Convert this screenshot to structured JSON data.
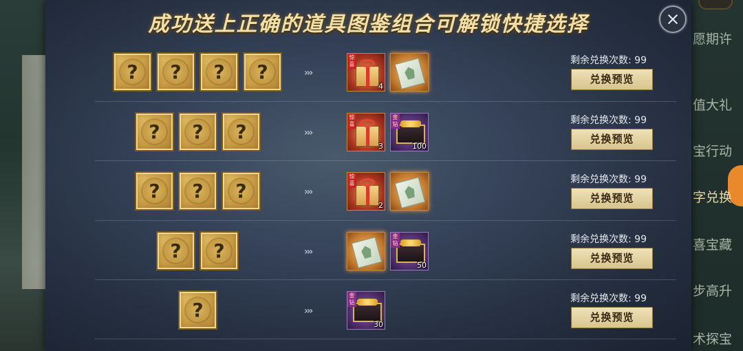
{
  "title": "成功送上正确的道具图鉴组合可解锁快捷选择",
  "sidebar": {
    "items": [
      {
        "label": "愿期许",
        "active": false
      },
      {
        "label": "值大礼",
        "active": false
      },
      {
        "label": "宝行动",
        "active": false
      },
      {
        "label": "字兑换",
        "active": true
      },
      {
        "label": "喜宝藏",
        "active": false
      },
      {
        "label": "步高升",
        "active": false
      },
      {
        "label": "术探宝",
        "active": false
      }
    ]
  },
  "mystery_glyph": "?",
  "arrow_glyph": "›››",
  "tags": {
    "gift": "惊喜",
    "gold": "金钻"
  },
  "rows": [
    {
      "mystery_count": 4,
      "rewards": [
        {
          "kind": "gift-box",
          "frame": "red",
          "tag": "惊喜",
          "qty": "4"
        },
        {
          "kind": "ticket",
          "frame": "orange",
          "tag": "",
          "qty": ""
        }
      ],
      "remaining_label": "剩余兑换次数: 99",
      "button_label": "兑换预览"
    },
    {
      "mystery_count": 3,
      "rewards": [
        {
          "kind": "gift-box",
          "frame": "red",
          "tag": "惊喜",
          "qty": "3"
        },
        {
          "kind": "chest",
          "frame": "purple",
          "tag": "金钻",
          "qty": "100"
        }
      ],
      "remaining_label": "剩余兑换次数: 99",
      "button_label": "兑换预览"
    },
    {
      "mystery_count": 3,
      "rewards": [
        {
          "kind": "gift-box",
          "frame": "red",
          "tag": "惊喜",
          "qty": "2"
        },
        {
          "kind": "ticket",
          "frame": "orange",
          "tag": "",
          "qty": ""
        }
      ],
      "remaining_label": "剩余兑换次数: 99",
      "button_label": "兑换预览"
    },
    {
      "mystery_count": 2,
      "rewards": [
        {
          "kind": "ticket",
          "frame": "orange",
          "tag": "",
          "qty": ""
        },
        {
          "kind": "chest",
          "frame": "purple",
          "tag": "金钻",
          "qty": "50"
        }
      ],
      "remaining_label": "剩余兑换次数: 99",
      "button_label": "兑换预览"
    },
    {
      "mystery_count": 1,
      "rewards": [
        {
          "kind": "chest",
          "frame": "purple",
          "tag": "金钻",
          "qty": "30"
        }
      ],
      "remaining_label": "剩余兑换次数: 99",
      "button_label": "兑换预览"
    }
  ],
  "colors": {
    "title_gold": "#f3e0a8",
    "mystery_gold": "#cfa44a",
    "button_cream": "#e6d5a4",
    "panel_blue": "#36435a"
  }
}
